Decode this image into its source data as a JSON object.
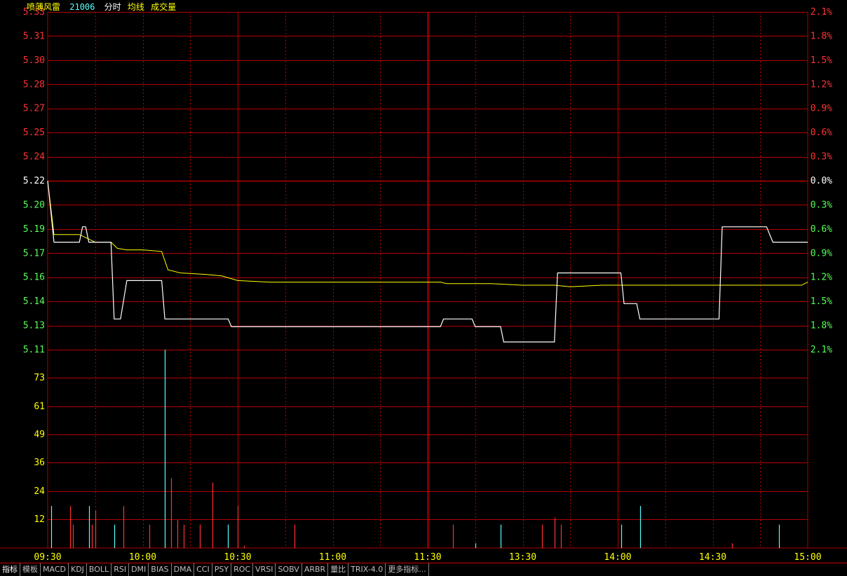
{
  "header": {
    "stock_name": "喷薄风雷",
    "code": "21006",
    "items": [
      "分时",
      "均线",
      "成交量"
    ]
  },
  "colors": {
    "grid": "#b40000",
    "up": "#ff3232",
    "down": "#54ff54",
    "flat": "#ffffff",
    "price_line": "#ffffff",
    "avg_line": "#ffff00",
    "vol_axis": "#ffff00",
    "header_name": "#ffff00",
    "header_code": "#54ffff",
    "vol_up": "#ff3232",
    "vol_down": "#54ffff",
    "time_label": "#ffff00"
  },
  "chart_data": {
    "type": "line",
    "title": "",
    "prev_close": 5.22,
    "price_axis": {
      "ylim": [
        5.11,
        5.33
      ],
      "ticks": [
        "5.33",
        "5.31",
        "5.30",
        "5.28",
        "5.27",
        "5.25",
        "5.24",
        "5.22",
        "5.20",
        "5.19",
        "5.17",
        "5.16",
        "5.14",
        "5.13",
        "5.11"
      ],
      "pct_ticks": [
        "2.1%",
        "1.8%",
        "1.5%",
        "1.2%",
        "0.9%",
        "0.6%",
        "0.3%",
        "0.0%",
        "0.3%",
        "0.6%",
        "0.9%",
        "1.2%",
        "1.5%",
        "1.8%",
        "2.1%"
      ]
    },
    "time_ticks": [
      "09:30",
      "10:00",
      "10:30",
      "11:00",
      "11:30",
      "13:30",
      "14:00",
      "14:30",
      "15:00"
    ],
    "price_series": {
      "name": "分时",
      "points": [
        [
          0,
          5.22
        ],
        [
          2,
          5.18
        ],
        [
          10,
          5.18
        ],
        [
          11,
          5.19
        ],
        [
          12,
          5.19
        ],
        [
          13,
          5.18
        ],
        [
          20,
          5.18
        ],
        [
          21,
          5.13
        ],
        [
          23,
          5.13
        ],
        [
          25,
          5.155
        ],
        [
          36,
          5.155
        ],
        [
          37,
          5.13
        ],
        [
          57,
          5.13
        ],
        [
          58,
          5.125
        ],
        [
          124,
          5.125
        ],
        [
          125,
          5.13
        ],
        [
          134,
          5.13
        ],
        [
          135,
          5.125
        ],
        [
          143,
          5.125
        ],
        [
          144,
          5.115
        ],
        [
          160,
          5.115
        ],
        [
          161,
          5.16
        ],
        [
          181,
          5.16
        ],
        [
          182,
          5.14
        ],
        [
          186,
          5.14
        ],
        [
          187,
          5.13
        ],
        [
          212,
          5.13
        ],
        [
          213,
          5.19
        ],
        [
          227,
          5.19
        ],
        [
          229,
          5.18
        ],
        [
          240,
          5.18
        ]
      ]
    },
    "avg_series": {
      "name": "均线",
      "points": [
        [
          0,
          5.22
        ],
        [
          2,
          5.185
        ],
        [
          10,
          5.185
        ],
        [
          12,
          5.183
        ],
        [
          15,
          5.18
        ],
        [
          20,
          5.18
        ],
        [
          22,
          5.176
        ],
        [
          25,
          5.175
        ],
        [
          30,
          5.175
        ],
        [
          36,
          5.174
        ],
        [
          38,
          5.162
        ],
        [
          42,
          5.16
        ],
        [
          50,
          5.159
        ],
        [
          55,
          5.158
        ],
        [
          60,
          5.155
        ],
        [
          70,
          5.154
        ],
        [
          100,
          5.154
        ],
        [
          124,
          5.154
        ],
        [
          126,
          5.153
        ],
        [
          140,
          5.153
        ],
        [
          150,
          5.152
        ],
        [
          160,
          5.152
        ],
        [
          165,
          5.151
        ],
        [
          175,
          5.152
        ],
        [
          200,
          5.152
        ],
        [
          230,
          5.152
        ],
        [
          238,
          5.152
        ],
        [
          240,
          5.154
        ]
      ]
    },
    "volume_axis": {
      "ylim": [
        0,
        85
      ],
      "ticks": [
        "73",
        "61",
        "49",
        "36",
        "24",
        "12"
      ]
    },
    "volume": [
      [
        1,
        18,
        "down"
      ],
      [
        7,
        18,
        "up"
      ],
      [
        8,
        10,
        "up"
      ],
      [
        13,
        18,
        "down"
      ],
      [
        14,
        10,
        "up"
      ],
      [
        15,
        16,
        "up"
      ],
      [
        21,
        10,
        "down"
      ],
      [
        24,
        18,
        "up"
      ],
      [
        32,
        10,
        "up"
      ],
      [
        37,
        85,
        "down"
      ],
      [
        39,
        30,
        "up"
      ],
      [
        41,
        12,
        "up"
      ],
      [
        43,
        10,
        "up"
      ],
      [
        48,
        10,
        "up"
      ],
      [
        52,
        28,
        "up"
      ],
      [
        57,
        10,
        "down"
      ],
      [
        60,
        18,
        "up"
      ],
      [
        62,
        1,
        "up"
      ],
      [
        78,
        10,
        "up"
      ],
      [
        128,
        10,
        "up"
      ],
      [
        135,
        2,
        "down"
      ],
      [
        143,
        10,
        "down"
      ],
      [
        156,
        10,
        "up"
      ],
      [
        160,
        13,
        "up"
      ],
      [
        162,
        10,
        "up"
      ],
      [
        181,
        10,
        "down"
      ],
      [
        187,
        18,
        "down"
      ],
      [
        216,
        2,
        "up"
      ],
      [
        231,
        10,
        "down"
      ]
    ]
  },
  "tabs": [
    "指标",
    "模板",
    "MACD",
    "KDJ",
    "BOLL",
    "RSI",
    "DMI",
    "BIAS",
    "DMA",
    "CCI",
    "PSY",
    "ROC",
    "VRSI",
    "SOBV",
    "ARBR",
    "量比",
    "TRIX-4.0",
    "更多指标..."
  ]
}
